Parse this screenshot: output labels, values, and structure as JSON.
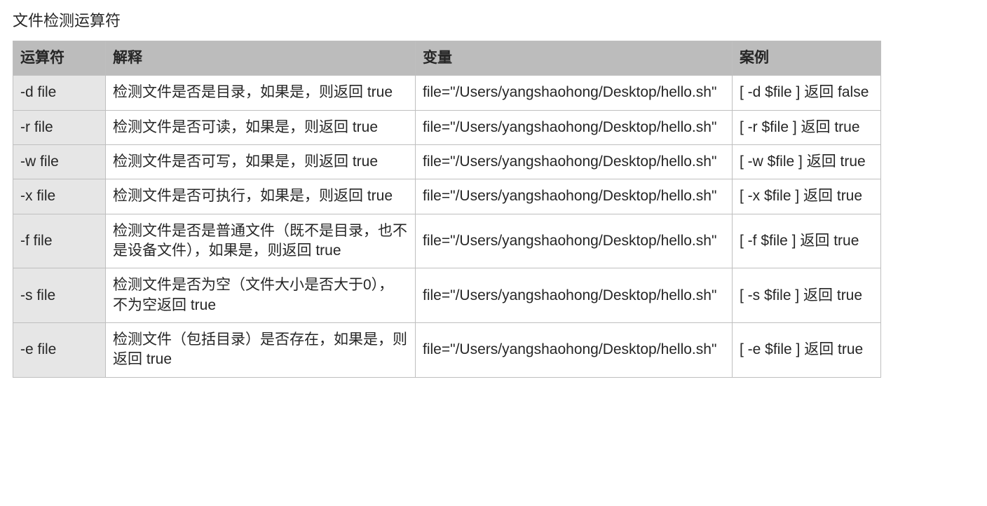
{
  "title": "文件检测运算符",
  "headers": {
    "operator": "运算符",
    "explain": "解释",
    "variable": "变量",
    "example": "案例"
  },
  "rows": [
    {
      "operator": "-d file",
      "explain": "检测文件是否是目录，如果是，则返回 true",
      "variable": "file=\"/Users/yangshaohong/Desktop/hello.sh\"",
      "example": "[ -d $file ] 返回 false"
    },
    {
      "operator": "-r file",
      "explain": "检测文件是否可读，如果是，则返回 true",
      "variable": "file=\"/Users/yangshaohong/Desktop/hello.sh\"",
      "example": "[ -r $file ] 返回 true"
    },
    {
      "operator": "-w file",
      "explain": "检测文件是否可写，如果是，则返回 true",
      "variable": "file=\"/Users/yangshaohong/Desktop/hello.sh\"",
      "example": "[ -w $file ] 返回 true"
    },
    {
      "operator": "-x file",
      "explain": "检测文件是否可执行，如果是，则返回 true",
      "variable": "file=\"/Users/yangshaohong/Desktop/hello.sh\"",
      "example": "[ -x $file ] 返回 true"
    },
    {
      "operator": "-f file",
      "explain": "检测文件是否是普通文件（既不是目录，也不是设备文件），如果是，则返回 true",
      "variable": "file=\"/Users/yangshaohong/Desktop/hello.sh\"",
      "example": "[ -f $file ] 返回 true"
    },
    {
      "operator": "-s file",
      "explain": "检测文件是否为空（文件大小是否大于0），不为空返回 true",
      "variable": "file=\"/Users/yangshaohong/Desktop/hello.sh\"",
      "example": "[ -s $file ] 返回 true"
    },
    {
      "operator": "-e file",
      "explain": "检测文件（包括目录）是否存在，如果是，则返回 true",
      "variable": "file=\"/Users/yangshaohong/Desktop/hello.sh\"",
      "example": "[ -e $file ] 返回 true"
    }
  ]
}
